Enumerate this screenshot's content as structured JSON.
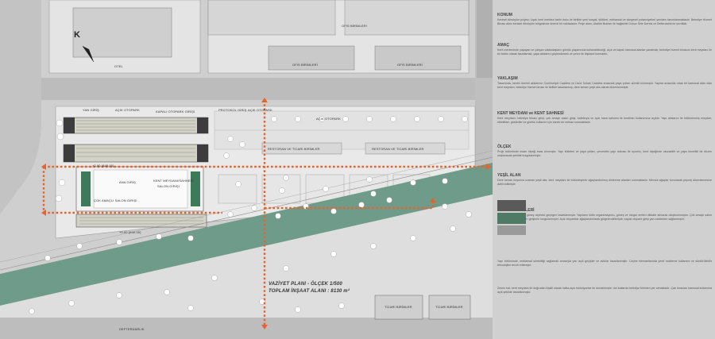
{
  "plan": {
    "north_letter": "K",
    "labels": {
      "otel": "OTEL",
      "ofis1": "OFİS BİRİMLERİ",
      "ofis2": "OFİS BİRİMLERİ",
      "ofis3": "OFİS BİRİMLERİ",
      "yan_giris": "YAN GİRİŞ",
      "acik_otopark1": "AÇIK OTOPARK",
      "kapali_otopark": "KAPALI OTOPARK GİRİŞİ",
      "protokol": "PROTOKOL GİRİŞ",
      "acik_otopark2": "AÇIK OTOPARK",
      "acik_otopark3": "AÇIK OTOPARK",
      "restoran1": "RESTORAN VE TİCARİ BİRİMLER",
      "restoran2": "RESTORAN VE TİCARİ BİRİMLER",
      "ana_giris": "ANA GİRİŞ",
      "kent_meydani": "KENT MEYDANI/SAHNESİ",
      "salon_girisi": "SALON GİRİŞİ",
      "cok_amacli": "ÇOK AMAÇLI SALON GİRİŞİ",
      "level1": "+2.00 (840.00)",
      "level2": "+0.00 (840.00)",
      "defterdarlik": "DEFTERDARLIK",
      "ticari1": "TİCARİ BİRİMLER",
      "ticari2": "TİCARİ BİRİMLER"
    },
    "caption_line1": "VAZİYET PLANI - ÖLÇEK 1/500",
    "caption_line2": "TOPLAM İNŞAAT ALANI : 8130 m²"
  },
  "report": {
    "sections": [
      {
        "title": "KONUM",
        "body": "Kentsel dönüşüm projesi; Uşak kent merkezi tarihi doku ile birlikte yeni sosyal, kültürel, mekansal ve simgesel potansiyelleri yeniden tanımlanmaktadır. Belediye Hizmet Binası alanı kentsel dönüşüm bölgesinde önemli bir noktadadır. Proje alanı, Atatürk Bulvarı ile bağlantılı Dokuz Sele Deresi ve Defterdarlık ile çevrilidir."
      },
      {
        "title": "AMAÇ",
        "body": "Kent merkezinde yaşayan ve çalışan vatandaşların günlük yaşamında kullanabileceği, açık ve kapalı kamusal alanlar yaratmak; belediye hizmet binasını kent meydanı ile bir bütün olarak tasarlamak; yaya akslarını güçlendirmek ve çevre ile ilişkisini kurmaktır."
      },
      {
        "title": "YAKLAŞIM",
        "body": "Tasarımda, kentin önemli akslarının Cumhuriyet Caddesi ve Ücüz Sokak Caddesi arasında yaya yolları sürekli kılınmıştır. Yapılar arasında ortak bir kamusal alan olan kent meydanı, belediye hizmet binası ile birlikte tasarlanmış; dere kenarı yeşil aks olarak düzenlenmiştir."
      },
      {
        "title": "KENT MEYDANI ve KENT SAHNESİ",
        "body": "Kent meydanı; belediye binası girişi, çok amaçlı salon girişi, kafeterya ve açık hava sahnesi ile kentlinin kullanımına açıktır. Yapı akslarını ile bütünlenmiş meydan; etkinlikler, gösteriler ve günlük kullanım için esnek bir mekan sunmaktadır."
      },
      {
        "title": "ÖLÇEK",
        "body": "Proje bütününde insan ölçeği esas alınmıştır. Yapı kütleleri ve yaya yolları, çevredeki yapı dokusu ile uyumlu, kent ölçeğinde okunabilir ve yaya öncelikli bir düzen oluşturacak şekilde kurgulanmıştır."
      },
      {
        "title": "YEŞİL ALAN",
        "body": "Dere kenarı boyunca uzanan yeşil aks, kent meydanı ile bütünleşerek ağaçlandırılmış dinlenme alanları sunmaktadır. Mevcut ağaçlar korunarak peyzaj düzenlemesine dahil edilmiştir."
      },
      {
        "title": "TASARIM İLKELERİ",
        "body": "Kuzey cephesi yoğun, güney cephesi geçirgen tasarlanmıştır. Yapıların kütle organizasyonu, güneş ve rüzgar verileri dikkate alınarak oluşturulmuştur. Çok amaçlı salon ve belediye birimleri ayrı girişlerle kurgulanmıştır. Açık otoparklar ağaçlandırılarak gölgelendirilmiştir; kapalı otopark girişi yan caddeden sağlanmıştır."
      },
      {
        "title": "",
        "body": "Yapı bütününde, mekansal sürekliliği sağlamak amacıyla yarı açık geçişler ve avlular tasarlanmıştır. Cephe elemanlarında yerel malzeme kullanımı ve sürdürülebilir teknolojiler tercih edilmiştir."
      },
      {
        "title": "",
        "body": "Zemin kat, kent meydanı ile doğrudan ilişkili olarak halka açık fonksiyonlar ile donatılmıştır; üst katlarda belediye birimleri yer almaktadır. Çatı terasları kamusal kullanıma açık şekilde tasarlanmıştır."
      }
    ]
  },
  "colors": {
    "background": "#d9d9d9",
    "road": "#bdbdbd",
    "building": "#e8e8e8",
    "green": "#6f9c8a",
    "path": "#e8632a",
    "dark": "#4a4a4a"
  }
}
